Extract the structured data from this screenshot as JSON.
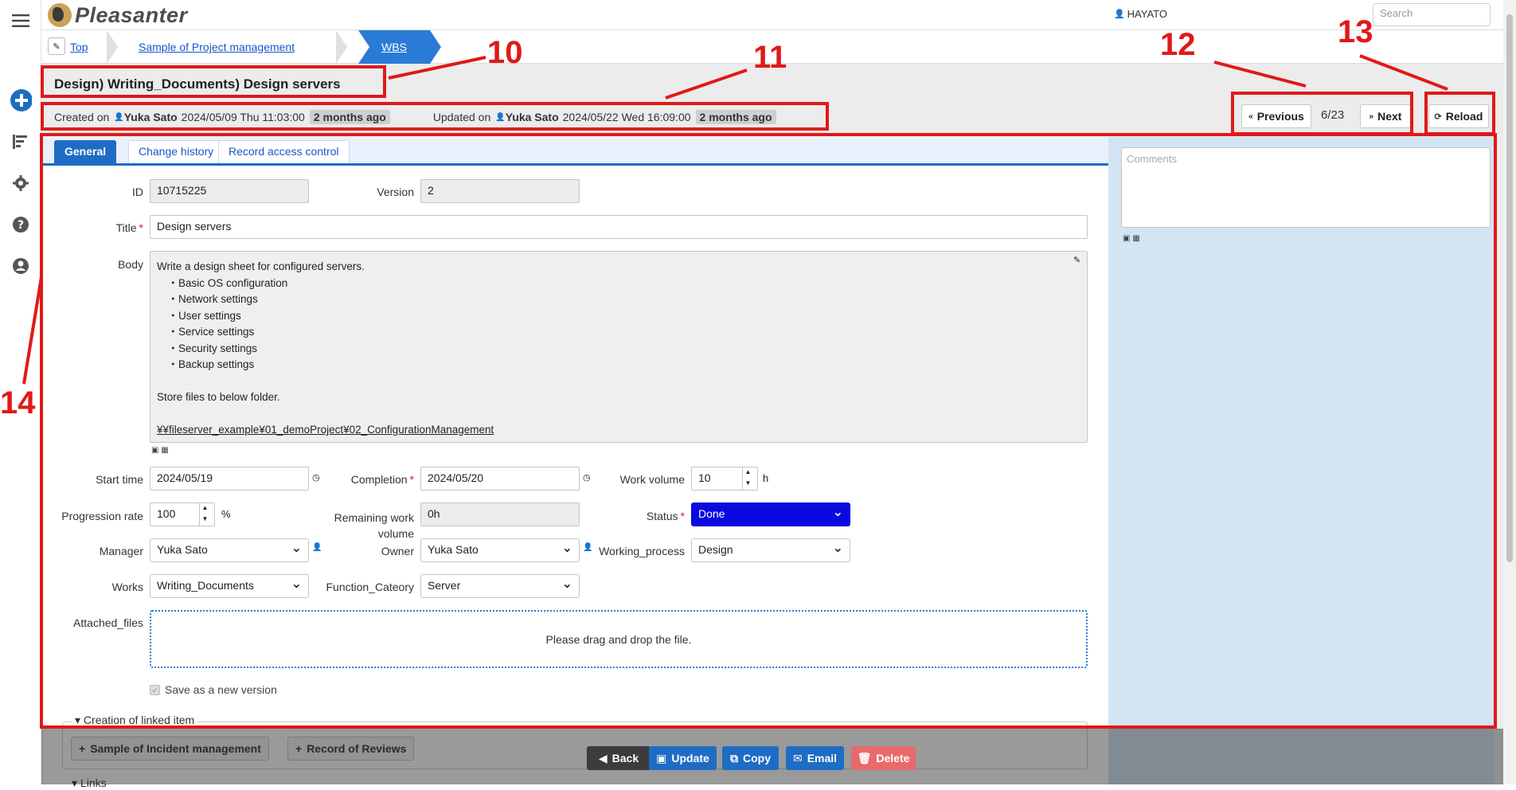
{
  "header": {
    "logo_text": "Pleasanter",
    "user_name": "HAYATO",
    "search_placeholder": "Search"
  },
  "breadcrumb": {
    "items": [
      "Top",
      "Sample of Project management",
      "WBS"
    ]
  },
  "record": {
    "title_path": "Design) Writing_Documents) Design servers",
    "created_label": "Created on",
    "created_by": "Yuka Sato",
    "created_at": "2024/05/09 Thu 11:03:00",
    "created_ago": "2 months ago",
    "updated_label": "Updated on",
    "updated_by": "Yuka Sato",
    "updated_at": "2024/05/22 Wed 16:09:00",
    "updated_ago": "2 months ago"
  },
  "nav": {
    "previous": "Previous",
    "position": "6/23",
    "next": "Next",
    "reload": "Reload"
  },
  "tabs": [
    "General",
    "Change history",
    "Record access control"
  ],
  "comments_placeholder": "Comments",
  "fields": {
    "id_label": "ID",
    "id_value": "10715225",
    "version_label": "Version",
    "version_value": "2",
    "title_label": "Title",
    "title_value": "Design servers",
    "body_label": "Body",
    "body_lines": [
      "Write a design sheet for configured servers.",
      "　・Basic OS configuration",
      "　・Network settings",
      "　・User settings",
      "　・Service settings",
      "　・Security settings",
      "　・Backup settings",
      "",
      "Store files to below folder.",
      ""
    ],
    "body_link": "¥¥fileserver_example¥01_demoProject¥02_ConfigurationManagement",
    "start_label": "Start time",
    "start_value": "2024/05/19",
    "completion_label": "Completion",
    "completion_value": "2024/05/20",
    "workvol_label": "Work volume",
    "workvol_value": "10",
    "workvol_unit": "h",
    "progress_label": "Progression rate",
    "progress_value": "100",
    "progress_unit": "%",
    "remaining_label": "Remaining work volume",
    "remaining_value": "0h",
    "status_label": "Status",
    "status_value": "Done",
    "manager_label": "Manager",
    "manager_value": "Yuka Sato",
    "owner_label": "Owner",
    "owner_value": "Yuka Sato",
    "process_label": "Working_process",
    "process_value": "Design",
    "works_label": "Works",
    "works_value": "Writing_Documents",
    "function_label": "Function_Cateory",
    "function_value": "Server",
    "attached_label": "Attached_files",
    "dropzone_text": "Please drag and drop the file.",
    "save_version_label": "Save as a new version"
  },
  "linked": {
    "section_label": "Creation of linked item",
    "buttons": [
      "Sample of Incident management",
      "Record of Reviews"
    ],
    "links_label": "Links"
  },
  "actions": {
    "back": "Back",
    "update": "Update",
    "copy": "Copy",
    "email": "Email",
    "delete": "Delete"
  },
  "annotations": [
    "10",
    "11",
    "12",
    "13",
    "14"
  ],
  "colors": {
    "accent": "#1e6cc4",
    "annotation": "#e01919",
    "status_done": "#0a0ae0",
    "delete": "#e86b6b"
  }
}
